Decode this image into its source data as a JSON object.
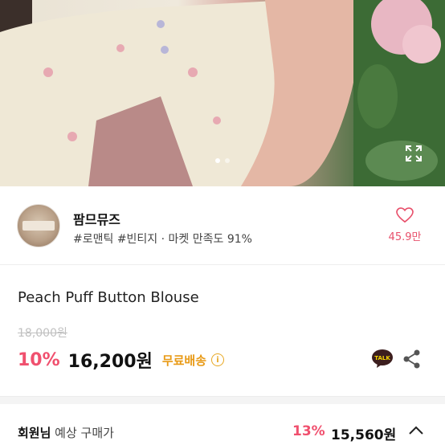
{
  "hero": {
    "image_alt": "Peach Puff Button Blouse product photo",
    "slide_count": 2,
    "active_slide": 1
  },
  "seller": {
    "name": "팜므뮤즈",
    "tags": "#로맨틱 #빈티지 · 마켓 만족도 91%",
    "like_count": "45.9만",
    "avatar_icon": "shop-avatar"
  },
  "product": {
    "title": "Peach Puff Button Blouse",
    "original_price": "18,000원",
    "discount": "10%",
    "price": "16,200원",
    "shipping": "무료배송",
    "info_icon": "i"
  },
  "member": {
    "label_bold": "회원님",
    "label_rest": " 예상 구매가",
    "discount": "13%",
    "price": "15,560원"
  },
  "colors": {
    "accent_pink": "#f0506e",
    "shipping_orange": "#e89a16",
    "heart_pink": "#e8506b"
  }
}
